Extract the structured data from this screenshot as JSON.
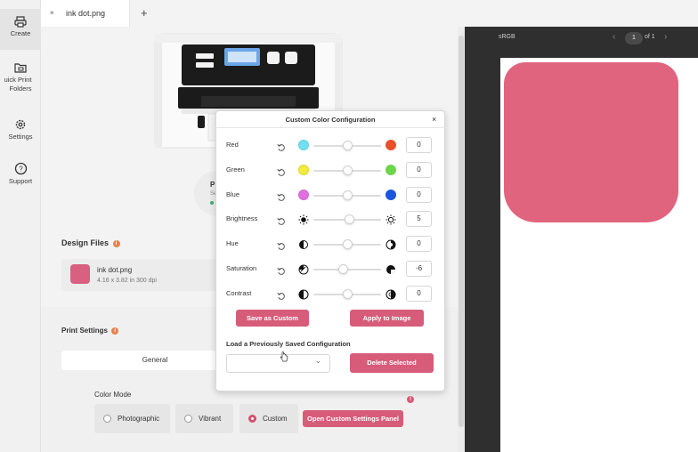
{
  "sidebar": {
    "items": [
      {
        "label": "Create",
        "icon": "printer-icon"
      },
      {
        "label": "uick Print\nFolders",
        "line1": "uick Print",
        "line2": "Folders",
        "icon": "folder-print-icon"
      },
      {
        "label": "Settings",
        "icon": "gear-icon"
      },
      {
        "label": "Support",
        "icon": "help-icon"
      }
    ]
  },
  "tabs": [
    {
      "label": "ink dot.png",
      "close": "×"
    }
  ],
  "tab_add": "+",
  "status": {
    "title": "P",
    "sub": "Se"
  },
  "design_files": {
    "title": "Design Files",
    "info": "i",
    "file": {
      "name": "ink dot.png",
      "meta": "4.16 x 3.82 in 300 dpi",
      "thumb_color": "#d96080"
    }
  },
  "print_settings": {
    "title": "Print Settings",
    "info": "i",
    "tab_general": "General",
    "color_mode_label": "Color Mode",
    "options": [
      "Photographic",
      "Vibrant",
      "Custom"
    ],
    "selected": "Custom",
    "open_panel_button": "Open Custom Settings Panel",
    "warning": "!"
  },
  "preview": {
    "profile": "sRGB",
    "page": "1",
    "of": "of 1",
    "prev": "‹",
    "next": "›",
    "shape_color": "#e0647e"
  },
  "dialog": {
    "title": "Custom Color Configuration",
    "close": "×",
    "rows": [
      {
        "label": "Red",
        "value": "0",
        "level": 0.5,
        "left_color": "#6ee0f0",
        "right_color": "#e8502a"
      },
      {
        "label": "Green",
        "value": "0",
        "level": 0.5,
        "left_color": "#f2ea3c",
        "right_color": "#6cd64a"
      },
      {
        "label": "Blue",
        "value": "0",
        "level": 0.5,
        "left_color": "#e070e0",
        "right_color": "#1a55e0"
      },
      {
        "label": "Brightness",
        "value": "5",
        "level": 0.53,
        "left_icon": "sun-filled-icon",
        "right_icon": "sun-outline-icon"
      },
      {
        "label": "Hue",
        "value": "0",
        "level": 0.5,
        "left_icon": "hue-left-icon",
        "right_icon": "hue-right-icon"
      },
      {
        "label": "Saturation",
        "value": "-6",
        "level": 0.44,
        "left_icon": "saturation-low-icon",
        "right_icon": "saturation-high-icon"
      },
      {
        "label": "Contrast",
        "value": "0",
        "level": 0.5,
        "left_icon": "contrast-low-icon",
        "right_icon": "contrast-high-icon"
      }
    ],
    "save_button": "Save as Custom",
    "apply_button": "Apply to Image",
    "load_label": "Load a Previously Saved Configuration",
    "load_value": "",
    "delete_button": "Delete Selected"
  }
}
